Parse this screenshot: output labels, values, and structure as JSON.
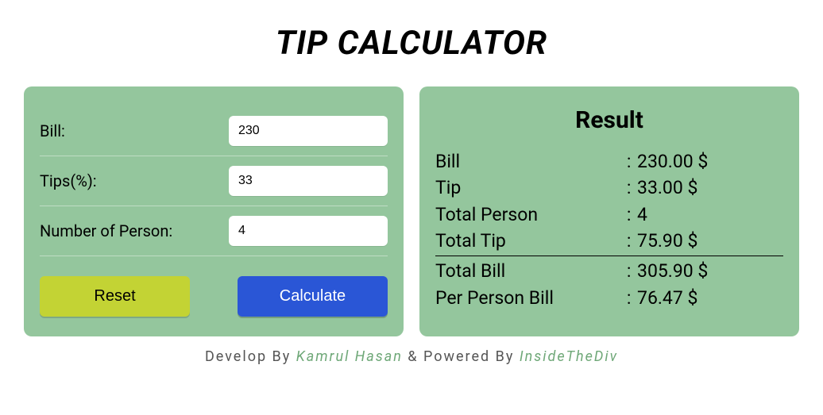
{
  "title": "TIP CALCULATOR",
  "form": {
    "bill_label": "Bill:",
    "bill_value": "230",
    "tips_label": "Tips(%):",
    "tips_value": "33",
    "person_label": "Number of Person:",
    "person_value": "4",
    "reset_label": "Reset",
    "calculate_label": "Calculate"
  },
  "result": {
    "heading": "Result",
    "rows": {
      "bill": {
        "label": "Bill",
        "value": "230.00 $"
      },
      "tip": {
        "label": "Tip",
        "value": "33.00 $"
      },
      "total_person": {
        "label": "Total Person",
        "value": "4"
      },
      "total_tip": {
        "label": "Total Tip",
        "value": "75.90 $"
      },
      "total_bill": {
        "label": "Total Bill",
        "value": "305.90 $"
      },
      "per_person": {
        "label": "Per Person Bill",
        "value": "76.47 $"
      }
    }
  },
  "footer": {
    "pre": "Develop By ",
    "author": "Kamrul Hasan",
    "mid": " & Powered By ",
    "powered": "InsideTheDiv"
  }
}
